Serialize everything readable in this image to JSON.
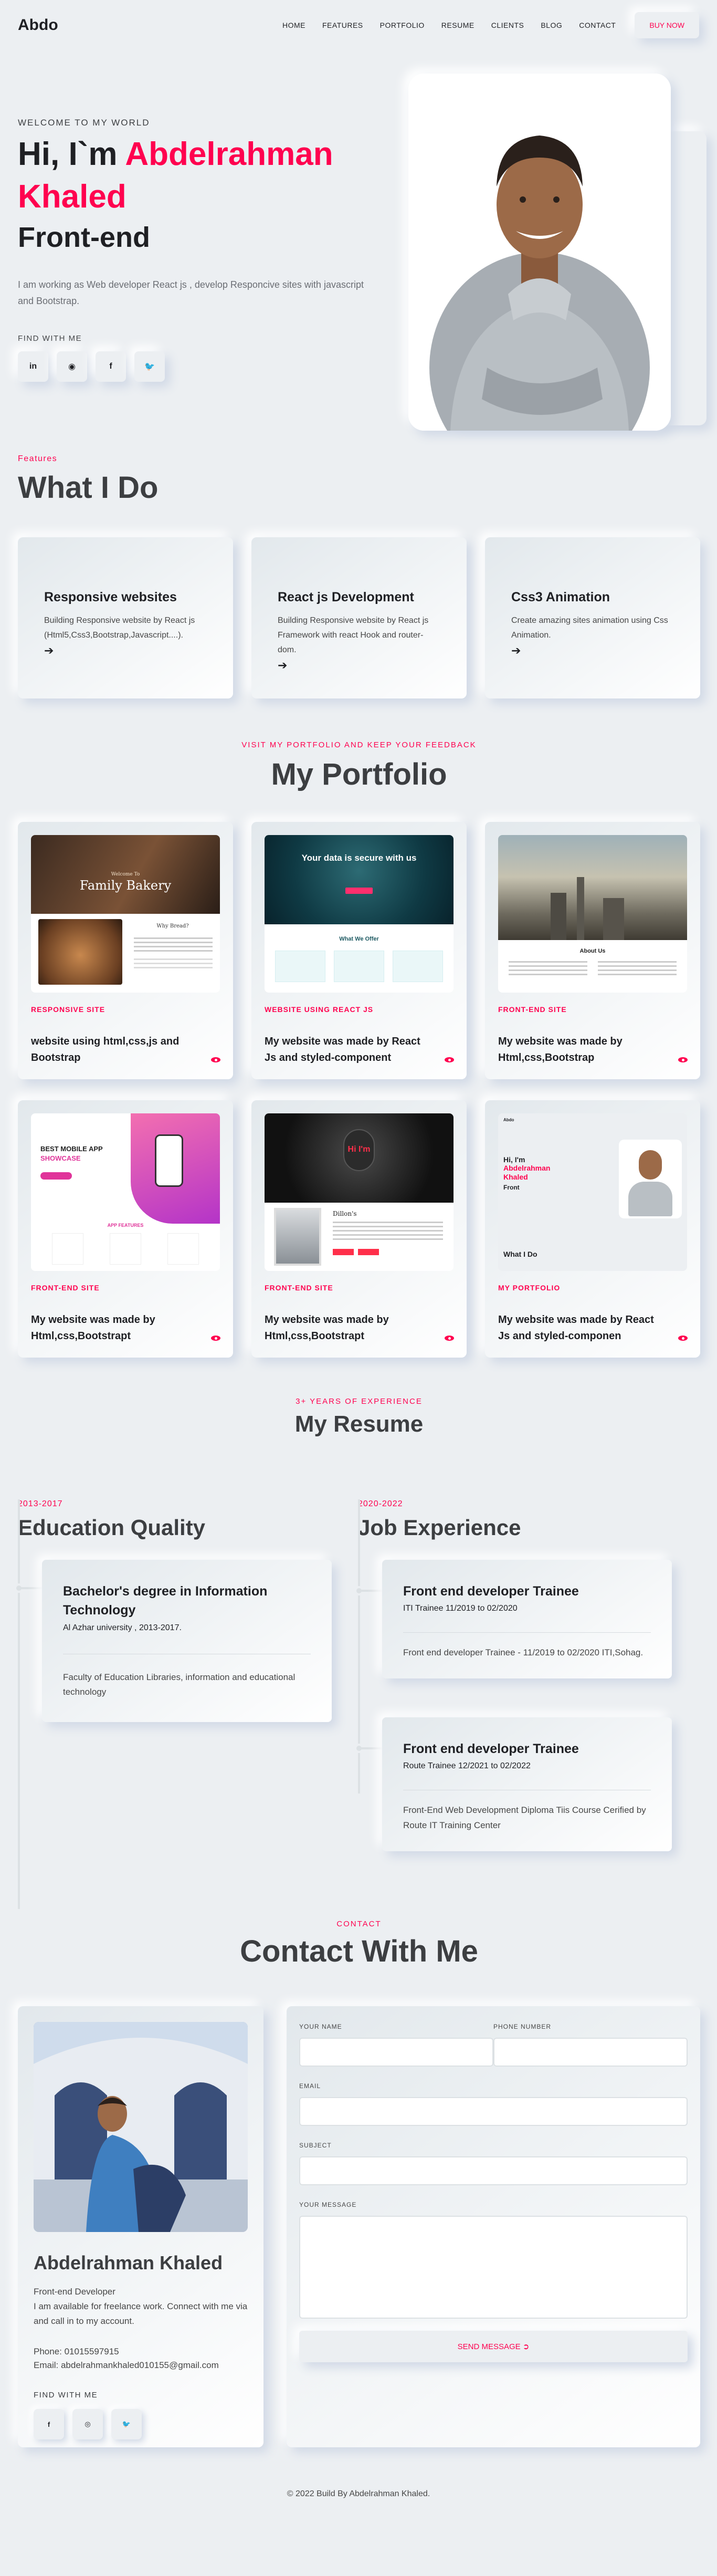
{
  "brand": "Abdo",
  "nav": {
    "items": [
      "HOME",
      "FEATURES",
      "PORTFOLIO",
      "RESUME",
      "CLIENTS",
      "BLOG",
      "CONTACT"
    ],
    "buy_label": "BUY NOW"
  },
  "hero": {
    "welcome": "WELCOME TO MY WORLD",
    "greeting": "Hi, I`m",
    "name": "Abdelrahman Khaled",
    "role": "Front-end",
    "description": "I am working as Web developer React js , develop Responcive sites with javascript and Bootstrap.",
    "find_label": "FIND WITH ME",
    "socials": [
      {
        "icon": "linkedin-icon",
        "glyph": "in"
      },
      {
        "icon": "github-icon",
        "glyph": "◉"
      },
      {
        "icon": "facebook-icon",
        "glyph": "f"
      },
      {
        "icon": "twitter-icon",
        "glyph": "🐦"
      }
    ]
  },
  "features": {
    "kicker": "Features",
    "title": "What I Do",
    "cards": [
      {
        "title": "Responsive websites",
        "text": "Building Responsive website by React js (Html5,Css3,Bootstrap,Javascript....).",
        "arrow": "➔"
      },
      {
        "title": "React js Development",
        "text": "Building Responsive website by React js Framework with react Hook and router-dom.",
        "arrow": "➔"
      },
      {
        "title": "Css3 Animation",
        "text": "Create amazing sites animation using Css Animation.",
        "arrow": "➔"
      }
    ]
  },
  "portfolio": {
    "kicker": "VISIT MY PORTFOLIO AND KEEP YOUR FEEDBACK",
    "title": "My Portfolio",
    "items": [
      {
        "tag": "RESPONSIVE SITE",
        "desc": "website using html,css,js and Bootstrap",
        "shot": {
          "heading": "Family Bakery",
          "sub": "Welcome To",
          "section": "Why Bread?"
        }
      },
      {
        "tag": "WEBSITE USING REACT JS",
        "desc": "My website was made by React Js and styled-component",
        "shot": {
          "heading": "Your data is secure with us",
          "section": "What We Offer"
        }
      },
      {
        "tag": "FRONT-END SITE",
        "desc": "My website was made by Html,css,Bootstrap",
        "shot": {
          "section": "About Us"
        }
      },
      {
        "tag": "FRONT-END SITE",
        "desc": "My website was made by Html,css,Bootstrapt",
        "shot": {
          "heading": "BEST MOBILE APP",
          "sub": "SHOWCASE",
          "section": "APP FEATURES"
        }
      },
      {
        "tag": "FRONT-END SITE",
        "desc": "My website was made by Html,css,Bootstrapt",
        "shot": {
          "heading": "Hi I'm",
          "section": "Dillon's"
        }
      },
      {
        "tag": "MY PORTFOLIO",
        "desc": "My website was made by React Js and styled-componen",
        "shot": {
          "brand": "Abdo",
          "greeting": "Hi, I'm",
          "name": "Abdelrahman Khaled",
          "role": "Front",
          "section": "What I Do"
        }
      }
    ]
  },
  "resume": {
    "kicker": "3+ YEARS OF EXPERIENCE",
    "title": "My Resume",
    "education": {
      "years": "2013-2017",
      "title": "Education Quality",
      "items": [
        {
          "title": "Bachelor's degree in Information Technology",
          "sub": "Al Azhar university , 2013-2017.",
          "text": "Faculty of Education Libraries, information and educational technology"
        }
      ]
    },
    "experience": {
      "years": "2020-2022",
      "title": "Job Experience",
      "items": [
        {
          "title": "Front end developer Trainee",
          "sub": "ITI Trainee 11/2019 to 02/2020",
          "text": "Front end developer Trainee - 11/2019 to 02/2020 ITI,Sohag."
        },
        {
          "title": "Front end developer Trainee",
          "sub": "Route Trainee 12/2021 to 02/2022",
          "text": "Front-End Web Development Diploma Tiis Course Cerified by Route IT Training Center"
        }
      ]
    }
  },
  "contact": {
    "kicker": "CONTACT",
    "title": "Contact With Me",
    "name": "Abdelrahman Khaled",
    "role": "Front-end Developer",
    "about": "I am available for freelance work. Connect with me via and call in to my account.",
    "phone": "Phone: 01015597915",
    "email": "Email: abdelrahmankhaled010155@gmail.com",
    "find_label": "FIND WITH ME",
    "socials": [
      {
        "icon": "facebook-icon",
        "glyph": "f"
      },
      {
        "icon": "instagram-icon",
        "glyph": "◎"
      },
      {
        "icon": "twitter-icon",
        "glyph": "🐦"
      }
    ],
    "form": {
      "name_label": "YOUR NAME",
      "phone_label": "PHONE NUMBER",
      "email_label": "EMAIL",
      "subject_label": "SUBJECT",
      "message_label": "YOUR MESSAGE",
      "send_label": "SEND MESSAGE ➲"
    }
  },
  "footer": "© 2022 Build By Abdelrahman Khaled.",
  "colors": {
    "accent": "#ff014f",
    "background": "#eceff2",
    "text": "#3c3e41"
  }
}
